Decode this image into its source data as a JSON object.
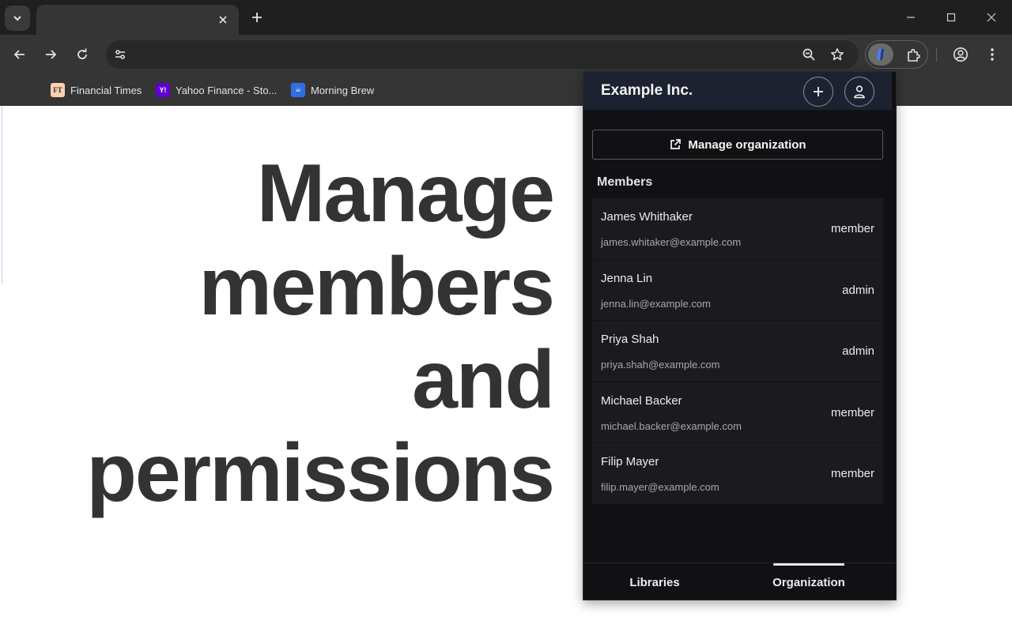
{
  "browser": {
    "tab_title": "",
    "omnibox_value": "",
    "bookmarks": [
      {
        "label": "Financial Times",
        "icon": "ft-favicon",
        "badge": "FT",
        "color": "#fcd0b1"
      },
      {
        "label": "Yahoo Finance - Sto...",
        "icon": "yahoo-favicon",
        "badge": "Y!",
        "color": "#6001d2"
      },
      {
        "label": "Morning Brew",
        "icon": "morning-brew-favicon",
        "badge": "☕",
        "color": "#2f6fe4"
      }
    ]
  },
  "hero": {
    "line1": "Manage",
    "line2": "members",
    "line3": "and",
    "line4": "permissions"
  },
  "popup": {
    "org_name": "Example Inc.",
    "manage_label": "Manage organization",
    "members_title": "Members",
    "members": [
      {
        "name": "James Whithaker",
        "email": "james.whitaker@example.com",
        "role": "member"
      },
      {
        "name": "Jenna Lin",
        "email": "jenna.lin@example.com",
        "role": "admin"
      },
      {
        "name": "Priya Shah",
        "email": "priya.shah@example.com",
        "role": "admin"
      },
      {
        "name": "Michael Backer",
        "email": "michael.backer@example.com",
        "role": "member"
      },
      {
        "name": "Filip Mayer",
        "email": "filip.mayer@example.com",
        "role": "member"
      }
    ],
    "tabs": [
      {
        "label": "Libraries",
        "active": false
      },
      {
        "label": "Organization",
        "active": true
      }
    ]
  },
  "colors": {
    "popup_bg": "#111114",
    "popup_header": "#1c2230",
    "row_bg": "#1b1b1f",
    "hero_text": "#333333"
  }
}
